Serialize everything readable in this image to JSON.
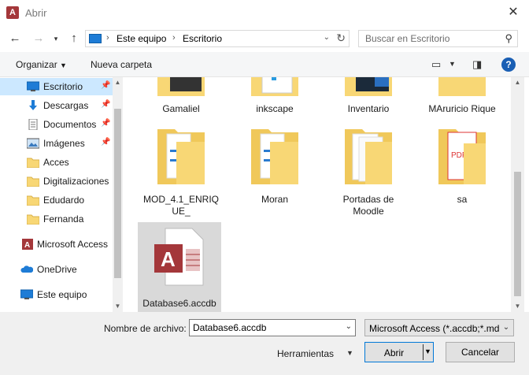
{
  "window": {
    "title": "Abrir",
    "app_icon_letter": "A"
  },
  "nav": {
    "breadcrumb": [
      "Este equipo",
      "Escritorio"
    ],
    "search_placeholder": "Buscar en Escritorio"
  },
  "toolbar": {
    "organize_label": "Organizar",
    "new_folder_label": "Nueva carpeta"
  },
  "sidebar": {
    "items": [
      {
        "label": "Escritorio",
        "icon": "desktop-icon",
        "pinned": true,
        "selected": true
      },
      {
        "label": "Descargas",
        "icon": "download-icon",
        "pinned": true
      },
      {
        "label": "Documentos",
        "icon": "document-icon",
        "pinned": true
      },
      {
        "label": "Imágenes",
        "icon": "image-icon",
        "pinned": true
      },
      {
        "label": "Acces",
        "icon": "folder-icon"
      },
      {
        "label": "Digitalizaciones",
        "icon": "folder-icon"
      },
      {
        "label": "Edudardo",
        "icon": "folder-icon"
      },
      {
        "label": "Fernanda",
        "icon": "folder-icon"
      },
      {
        "label": "Microsoft Access",
        "icon": "access-icon"
      },
      {
        "label": "OneDrive",
        "icon": "cloud-icon"
      },
      {
        "label": "Este equipo",
        "icon": "computer-icon"
      }
    ]
  },
  "files": {
    "row1": [
      "Gamaliel",
      "inkscape",
      "Inventario",
      "MAruricio Rique"
    ],
    "row2": [
      "MOD_4.1_ENRIQUE_",
      "Moran",
      "Portadas de Moodle",
      "sa"
    ],
    "row3": [
      "Database6.accdb"
    ],
    "mod_label_line1": "MOD_4.1_ENRIQ",
    "mod_label_line2": "UE_",
    "portadas_line1": "Portadas de",
    "portadas_line2": "Moodle"
  },
  "bottom": {
    "filename_label": "Nombre de archivo:",
    "filename_value": "Database6.accdb",
    "filetype_value": "Microsoft Access (*.accdb;*.mdb)",
    "tools_label": "Herramientas",
    "open_label": "Abrir",
    "cancel_label": "Cancelar"
  },
  "colors": {
    "accent": "#0078d7",
    "selection": "#cce8ff",
    "folder": "#f8d775",
    "access": "#a4373a"
  }
}
